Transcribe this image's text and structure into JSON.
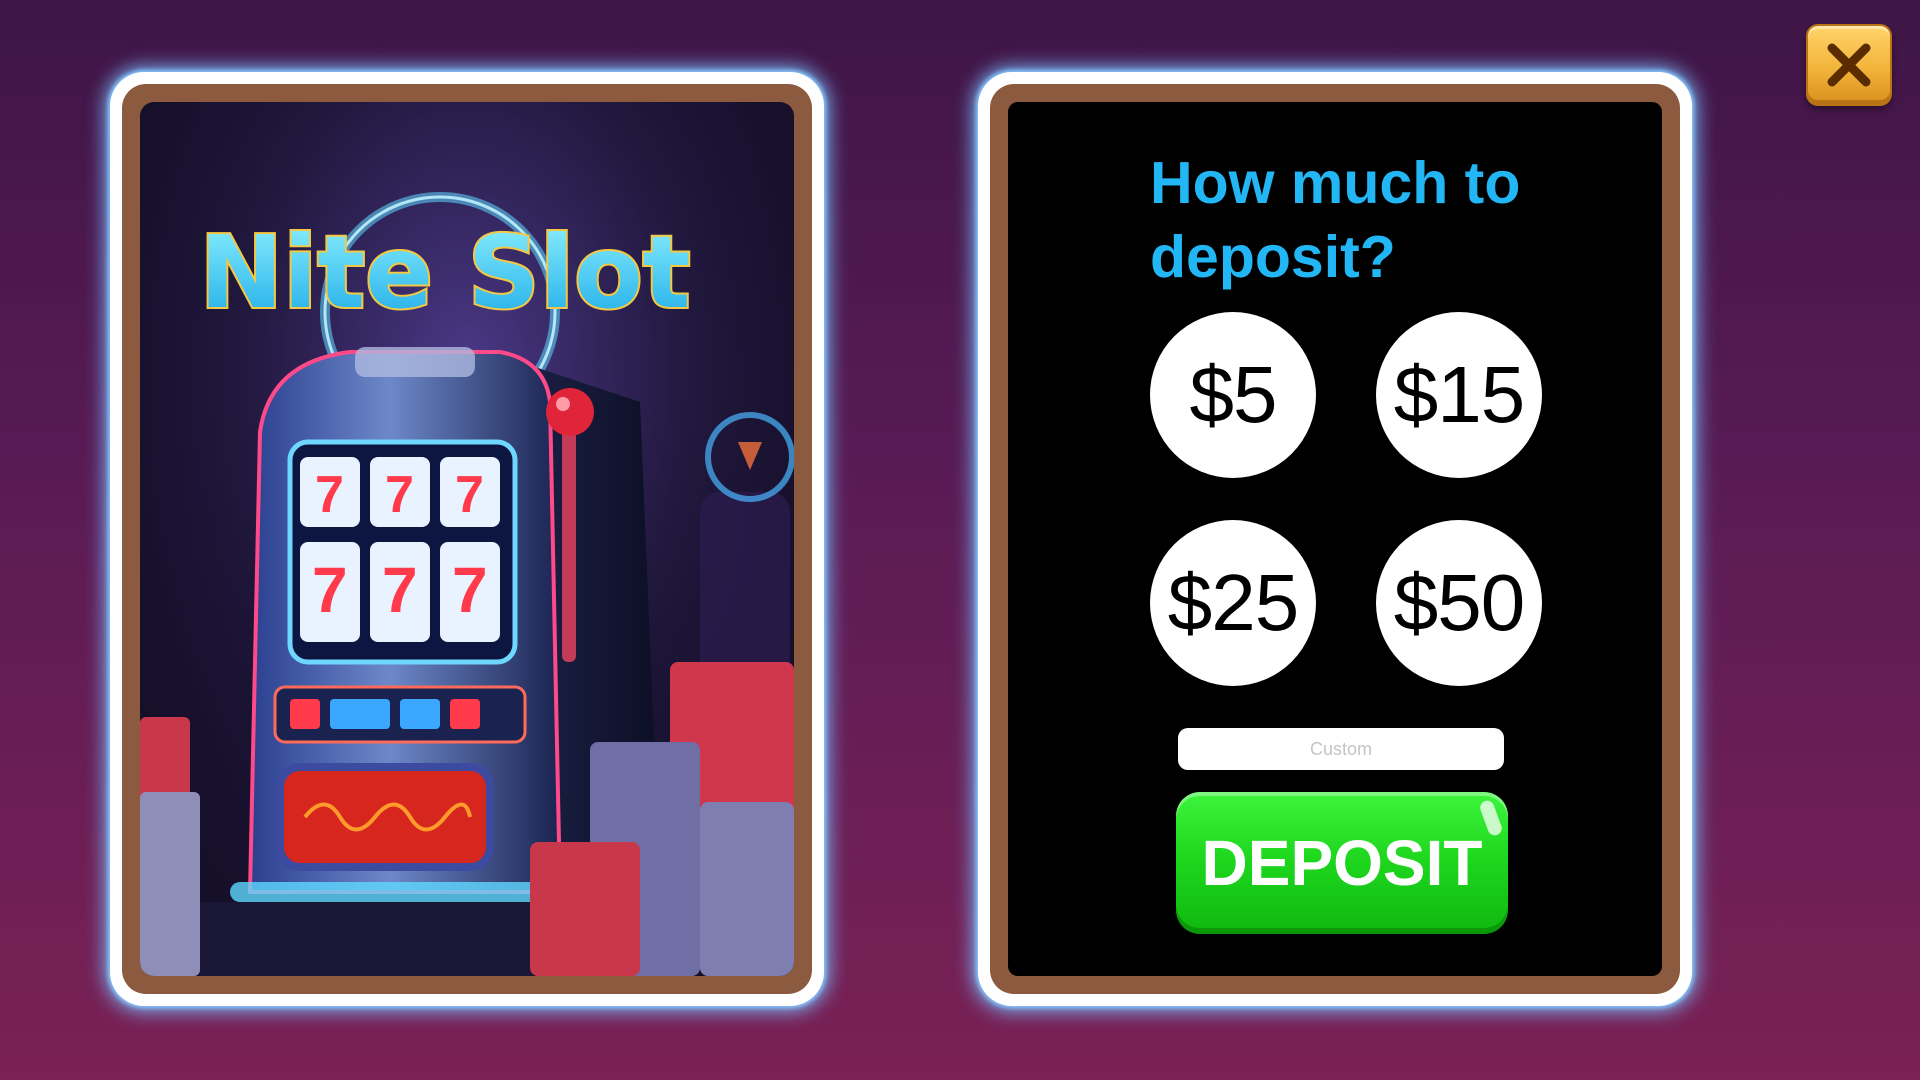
{
  "close": {
    "label": "×"
  },
  "promo": {
    "logo_text": "Nite Slot",
    "reel_symbols": [
      "7",
      "7",
      "7",
      "7",
      "7",
      "7"
    ]
  },
  "deposit": {
    "question": "How much to deposit?",
    "amounts": [
      "$5",
      "$15",
      "$25",
      "$50"
    ],
    "custom_placeholder": "Custom",
    "custom_value": "",
    "button_label": "DEPOSIT"
  },
  "colors": {
    "question_text": "#22b6f5",
    "deposit_button": "#1fd81f",
    "close_button": "#f2b43a",
    "card_frame": "#8b5a3f"
  }
}
